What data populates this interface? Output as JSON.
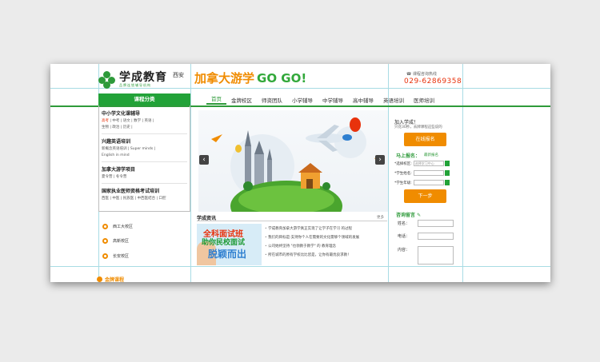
{
  "header": {
    "logo_name": "学成教育",
    "logo_slogan": "品牌连锁辅导机构",
    "city": "西安",
    "promo_main": "加拿大游学",
    "promo_go": "GO GO!",
    "hotline_label": "课程咨询热线",
    "hotline_number": "029-62869358"
  },
  "nav": {
    "items": [
      "首页",
      "金牌校区",
      "师资团队",
      "小学辅导",
      "中学辅导",
      "高中辅导",
      "英语培训",
      "医师培训"
    ]
  },
  "category": {
    "title": "课程分类",
    "groups": [
      {
        "title": "中小学文化课辅导",
        "links_highlight": "高考",
        "links": " | 中考 | 语文 | 数学 | 英语 |",
        "links2": "生物 | 政治 | 历史 |"
      },
      {
        "title": "兴趣英语培训",
        "links": "新概念英语培训 | Super minds |",
        "links2": "English in mind"
      },
      {
        "title": "加拿大游学项目",
        "links": "夏令营 | 冬令营"
      },
      {
        "title": "国家执业医师资格考试培训",
        "links": "西医 | 中医 | 民族医 | 中西医结合 | 口腔"
      }
    ]
  },
  "campuses": [
    "西工大校区",
    "高新校区",
    "长安校区"
  ],
  "bottom_section": "金牌课程",
  "news": {
    "title": "学成资讯",
    "more": "更多",
    "image_lines": [
      "全科面试班",
      "助你民校面试",
      "脱颖而出"
    ],
    "items": [
      "学成教育加拿大游学真正实现了让学子在学习 的过程",
      "我们的目标是:支持你个人在需要的文化需够个领域的发展",
      "公司始终坚持 \"也领教于教学\" 的 教育理念",
      "所在城市的原有学校比比皆是，让你有最优良求教！"
    ]
  },
  "join": {
    "title": "加入学成！",
    "text": "只花30秒，去牌课程这些说的",
    "button": "在线报名"
  },
  "signup": {
    "title": "马上报名：",
    "tip": "最新报名",
    "rows": [
      {
        "label": "*选择校区:",
        "placeholder": "选择学习中心"
      },
      {
        "label": "*学生姓名:",
        "placeholder": ""
      },
      {
        "label": "*学生年级:",
        "placeholder": ""
      }
    ],
    "button": "下一步"
  },
  "consult": {
    "title": "咨询留言",
    "name_label": "姓名：",
    "phone_label": "电话：",
    "content_label": "内容："
  },
  "colors": {
    "brand_green": "#2e9a3a",
    "accent_orange": "#f08c00",
    "hotline_red": "#e8320c"
  }
}
